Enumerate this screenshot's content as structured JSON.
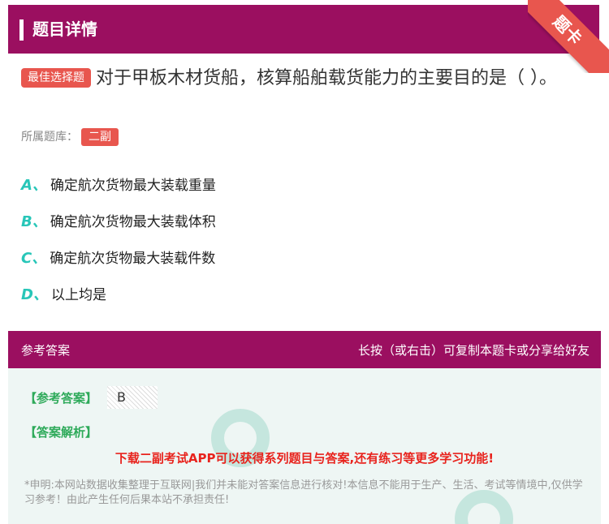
{
  "header": {
    "title": "题目详情",
    "ribbon": "题卡"
  },
  "question": {
    "badge": "最佳选择题",
    "text": "对于甲板木材货船，核算船舶载货能力的主要目的是（ ）。"
  },
  "bank": {
    "label": "所属题库：",
    "tag": "二副"
  },
  "options": [
    {
      "letter": "A、",
      "text": "确定航次货物最大装载重量"
    },
    {
      "letter": "B、",
      "text": "确定航次货物最大装载体积"
    },
    {
      "letter": "C、",
      "text": "确定航次货物最大装载件数"
    },
    {
      "letter": "D、",
      "text": "以上均是"
    }
  ],
  "answer_section": {
    "title": "参考答案",
    "hint": "长按（或右击）可复制本题卡或分享给好友",
    "ref_label": "【参考答案】",
    "ref_value": "B",
    "exp_label": "【答案解析】",
    "promo": "下载二副考试APP可以获得系列题目与答案,还有练习等更多学习功能!",
    "disclaimer": "*申明:本网站数据收集整理于互联网|我们并未能对答案信息进行核对!本信息不能用于生产、生活、考试等情境中,仅供学习参考！由此产生任何后果本站不承担责任!"
  },
  "colors": {
    "brand": "#9b0f60",
    "accent": "#e8564e",
    "option_letter": "#28c6b8",
    "answer_label": "#2eaa5a",
    "promo": "#e8231d"
  }
}
